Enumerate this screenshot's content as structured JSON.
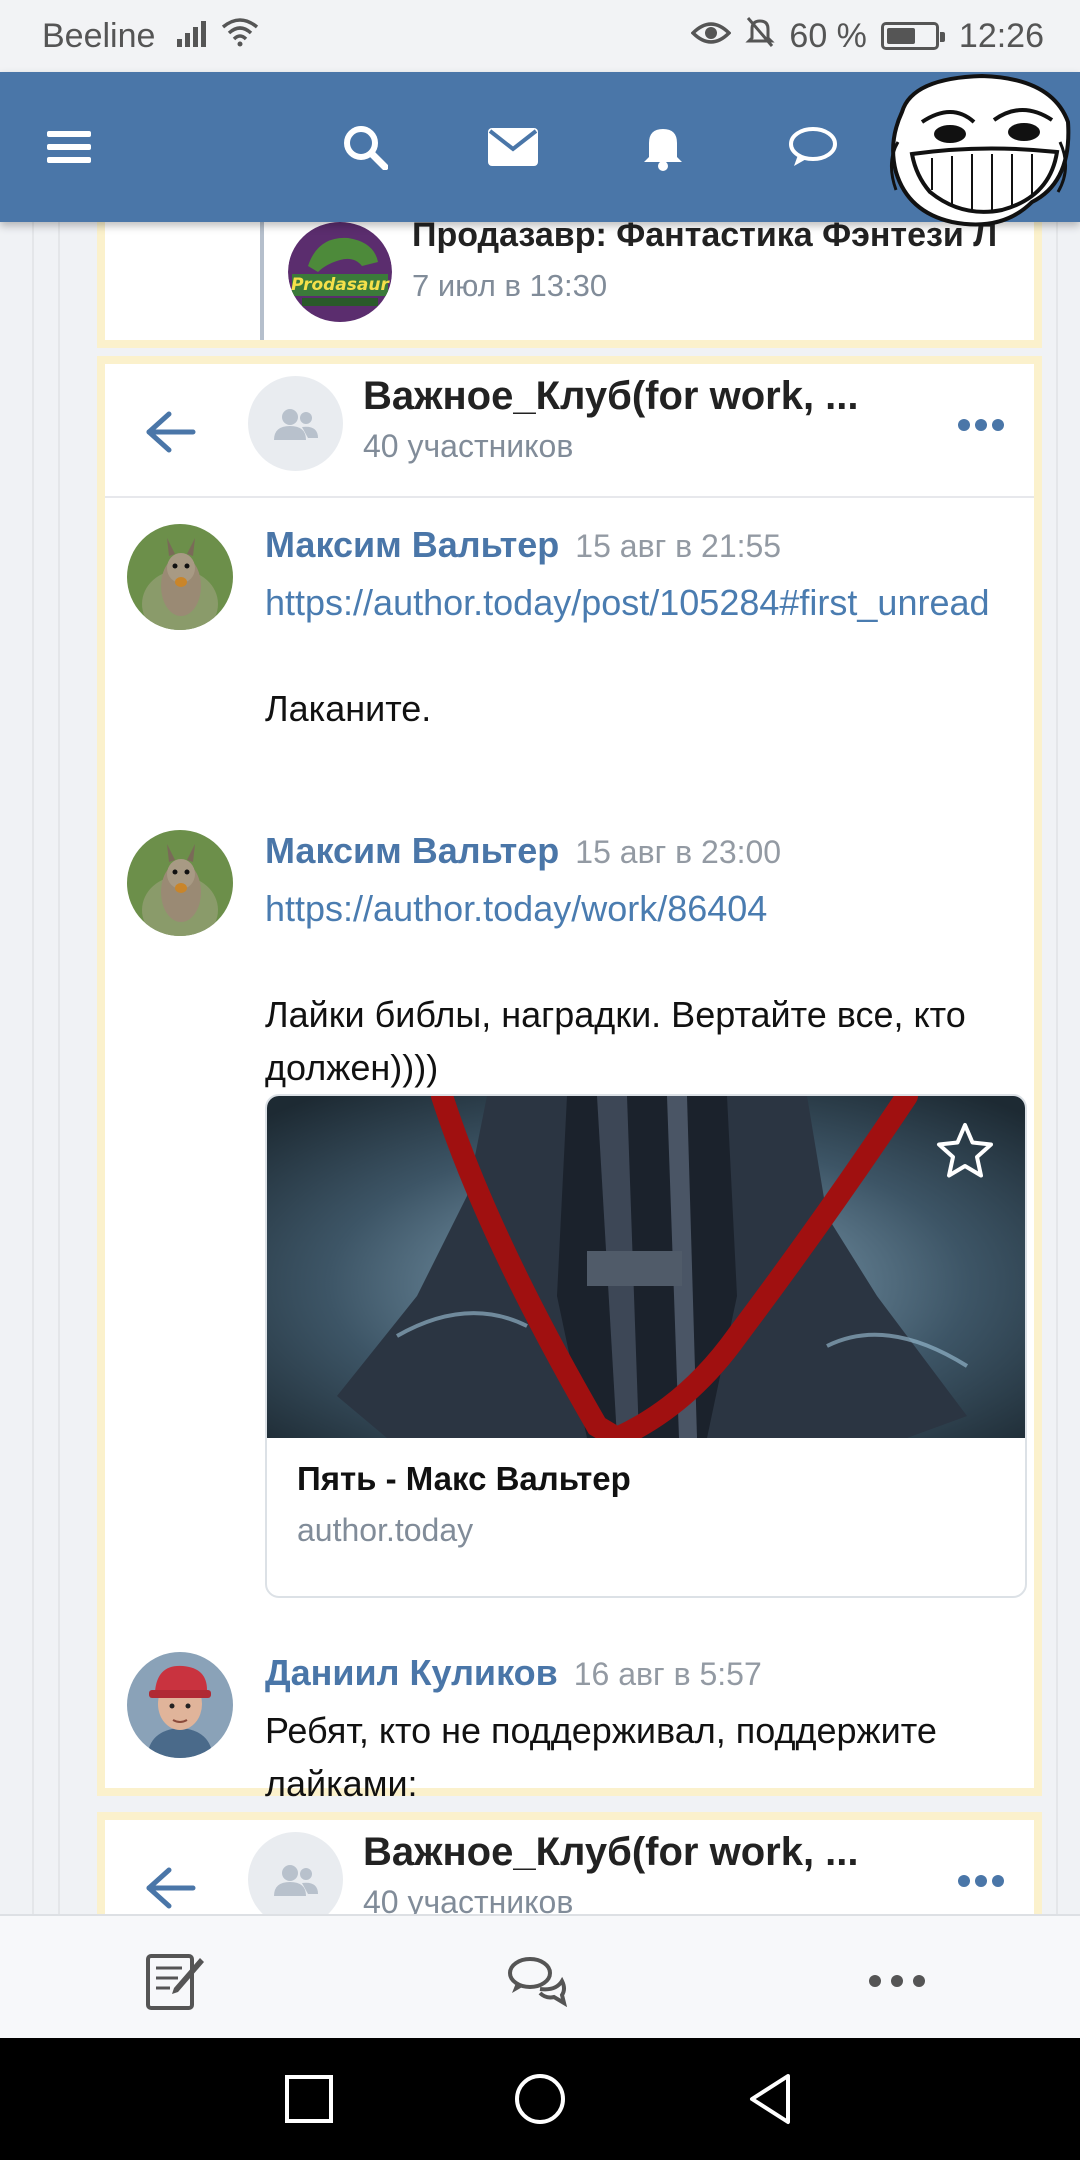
{
  "status_bar": {
    "carrier": "Beeline",
    "battery_percent": "60 %",
    "battery_level": 0.6,
    "time": "12:26",
    "icons": [
      "signal-icon",
      "wifi-icon",
      "eye-icon",
      "mute-bell-icon",
      "battery-icon"
    ]
  },
  "top_nav": {
    "color": "#4a76a8",
    "items": [
      "menu-icon",
      "search-icon",
      "mail-icon",
      "bell-icon",
      "chat-icon"
    ]
  },
  "repost": {
    "name": "Продазавр: Фантастика Фэнтези Л",
    "date": "7 июл в 13:30",
    "avatar_logo": "Prodasaur"
  },
  "chat": {
    "title": "Важное_Клуб(for work, ...",
    "members": "40 участников",
    "messages": [
      {
        "author": "Максим Вальтер",
        "time": "15 авг в 21:55",
        "link": "https://author.today/post/105284#first_unread",
        "text": "Лаканите."
      },
      {
        "author": "Максим Вальтер",
        "time": "15 авг в 23:00",
        "link": "https://author.today/work/86404",
        "text": "Лайки библы, наградки. Вертайте все, кто должен))))",
        "attachment": {
          "title": "Пять - Макс Вальтер",
          "domain": "author.today"
        }
      },
      {
        "author": "Даниил Куликов",
        "time": "16 авг в 5:57",
        "text": "Ребят, кто не поддерживал, поддержите лайками:"
      }
    ]
  },
  "chat_repeat": {
    "title": "Важное_Клуб(for work, ...",
    "members": "40 участников"
  },
  "bottom_bar": {
    "items": [
      "compose-icon",
      "messages-icon",
      "more-icon"
    ]
  }
}
